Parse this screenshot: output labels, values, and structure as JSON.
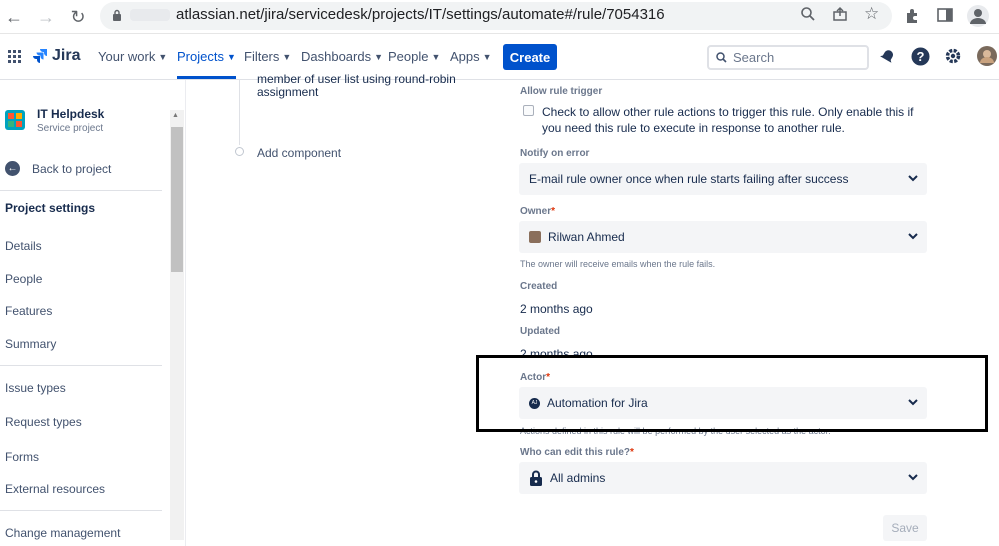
{
  "browser": {
    "url": "atlassian.net/jira/servicedesk/projects/IT/settings/automate#/rule/7054316"
  },
  "topnav": {
    "logo": "Jira",
    "items": [
      {
        "label": "Your work"
      },
      {
        "label": "Projects"
      },
      {
        "label": "Filters"
      },
      {
        "label": "Dashboards"
      },
      {
        "label": "People"
      },
      {
        "label": "Apps"
      }
    ],
    "create_label": "Create",
    "search_placeholder": "Search",
    "active_item": "Projects"
  },
  "sidebar": {
    "project_name": "IT Helpdesk",
    "project_type": "Service project",
    "back_label": "Back to project",
    "heading": "Project settings",
    "items": [
      {
        "label": "Details"
      },
      {
        "label": "People"
      },
      {
        "label": "Features"
      },
      {
        "label": "Summary"
      },
      {
        "label": "Issue types"
      },
      {
        "label": "Request types"
      },
      {
        "label": "Forms"
      },
      {
        "label": "External resources"
      },
      {
        "label": "Change management"
      }
    ]
  },
  "flow": {
    "cut_text": "member of user list using round-robin",
    "assignment_text": "assignment",
    "add_component": "Add component"
  },
  "details": {
    "allow_trigger_label": "Allow rule trigger",
    "allow_trigger_text": "Check to allow other rule actions to trigger this rule. Only enable this if you need this rule to execute in response to another rule.",
    "notify_label": "Notify on error",
    "notify_value": "E-mail rule owner once when rule starts failing after success",
    "owner_label": "Owner",
    "owner_value": "Rilwan Ahmed",
    "owner_help": "The owner will receive emails when the rule fails.",
    "created_label": "Created",
    "created_value": "2 months ago",
    "updated_label": "Updated",
    "updated_value": "2 months ago",
    "actor_label": "Actor",
    "actor_value": "Automation for Jira",
    "actor_initials": "AJ",
    "actor_help": "Actions defined in this rule will be performed by the user selected as the actor.",
    "edit_label": "Who can edit this rule?",
    "edit_value": "All admins",
    "save_label": "Save",
    "required_mark": "*"
  },
  "colors": {
    "brand": "#0052cc",
    "required": "#de350b"
  }
}
